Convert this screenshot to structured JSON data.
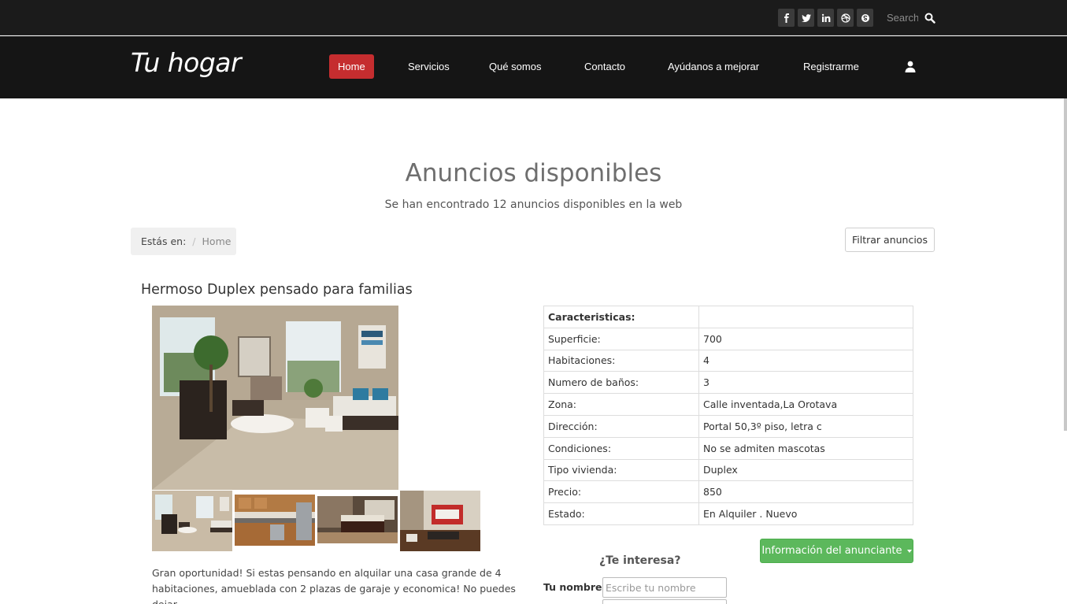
{
  "topbar": {
    "social_icons": [
      "facebook-icon",
      "twitter-icon",
      "linkedin-icon",
      "dribbble-icon",
      "skype-icon"
    ],
    "search_placeholder": "Search"
  },
  "navbar": {
    "brand": "Tu hogar",
    "items": [
      {
        "label": "Home",
        "active": true
      },
      {
        "label": "Servicios"
      },
      {
        "label": "Qué somos"
      },
      {
        "label": "Contacto"
      },
      {
        "label": "Ayúdanos a mejorar"
      },
      {
        "label": "Registrarme"
      }
    ],
    "accent_color": "#c52d2f"
  },
  "header": {
    "title": "Anuncios disponibles",
    "subtitle": "Se han encontrado 12 anuncios disponibles en la web"
  },
  "breadcrumb": {
    "label": "Estás en:",
    "separator": "/",
    "current": "Home"
  },
  "filter_button": "Filtrar anuncios",
  "listing": {
    "title": "Hermoso Duplex pensado para familias",
    "description": "Gran oportunidad! Si estas pensando en alquilar una casa grande de 4 habitaciones, amueblada con 2 plazas de garaje y economica! No puedes dejar",
    "features_header": "Caracteristicas:",
    "features": [
      {
        "key": "Superficie:",
        "value": "700"
      },
      {
        "key": "Habitaciones:",
        "value": "4"
      },
      {
        "key": "Numero de baños:",
        "value": "3"
      },
      {
        "key": "Zona:",
        "value": "Calle inventada,La Orotava"
      },
      {
        "key": "Dirección:",
        "value": "Portal 50,3º piso, letra c"
      },
      {
        "key": "Condiciones:",
        "value": "No se admiten mascotas"
      },
      {
        "key": "Tipo vivienda:",
        "value": "Duplex"
      },
      {
        "key": "Precio:",
        "value": "850"
      },
      {
        "key": "Estado:",
        "value": "En Alquiler . Nuevo"
      }
    ],
    "info_button": "Información del anunciante",
    "interest_title": "¿Te interesa?",
    "name_label": "Tu nombre:",
    "name_placeholder": "Escribe tu nombre",
    "button_color": "#5cb85c"
  }
}
